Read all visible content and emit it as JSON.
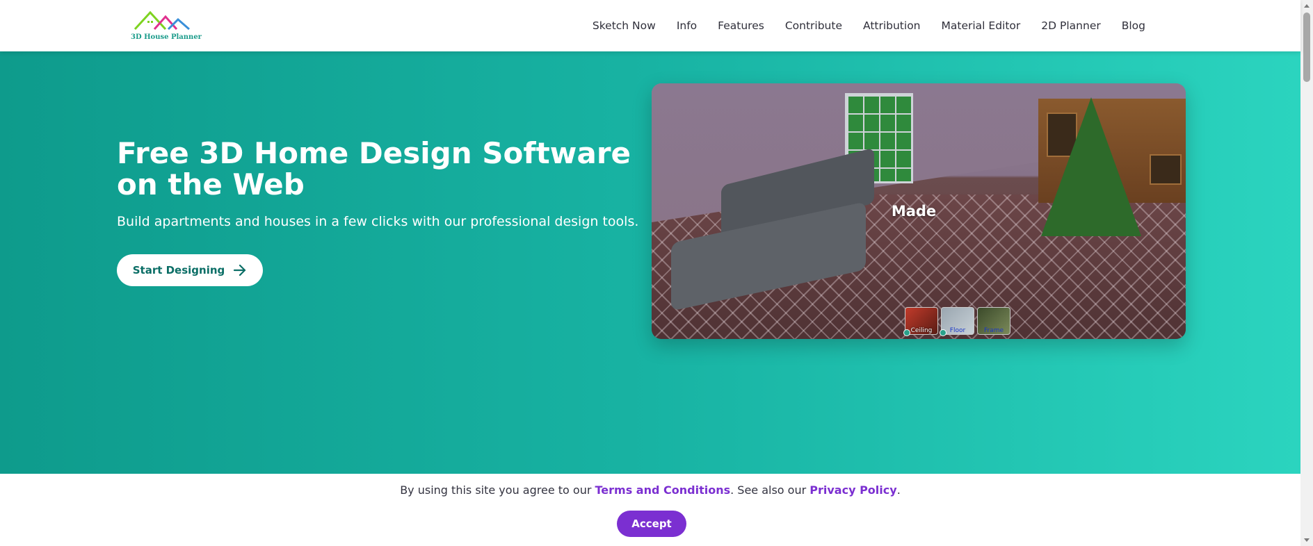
{
  "header": {
    "logo_text": "3D House Planner",
    "nav": [
      "Sketch Now",
      "Info",
      "Features",
      "Contribute",
      "Attribution",
      "Material Editor",
      "2D Planner",
      "Blog"
    ]
  },
  "hero": {
    "title": "Free 3D Home Design Software on the Web",
    "subtitle": "Build apartments and houses in a few clicks with our professional design tools.",
    "cta_label": "Start Designing",
    "cta_icon": "arrow-right-icon",
    "background_colors": [
      "#0e9b8c",
      "#2bd4bf"
    ]
  },
  "preview": {
    "overlay_text": "Made",
    "thumbnails": [
      "Ceiling",
      "Floor",
      "Frame"
    ]
  },
  "cookie": {
    "text_before": "By using this site you agree to our ",
    "terms_link": "Terms and Conditions",
    "text_middle": ". See also our ",
    "privacy_link": "Privacy Policy",
    "text_after": ".",
    "accept_label": "Accept",
    "accent_color": "#7b2fd1"
  }
}
